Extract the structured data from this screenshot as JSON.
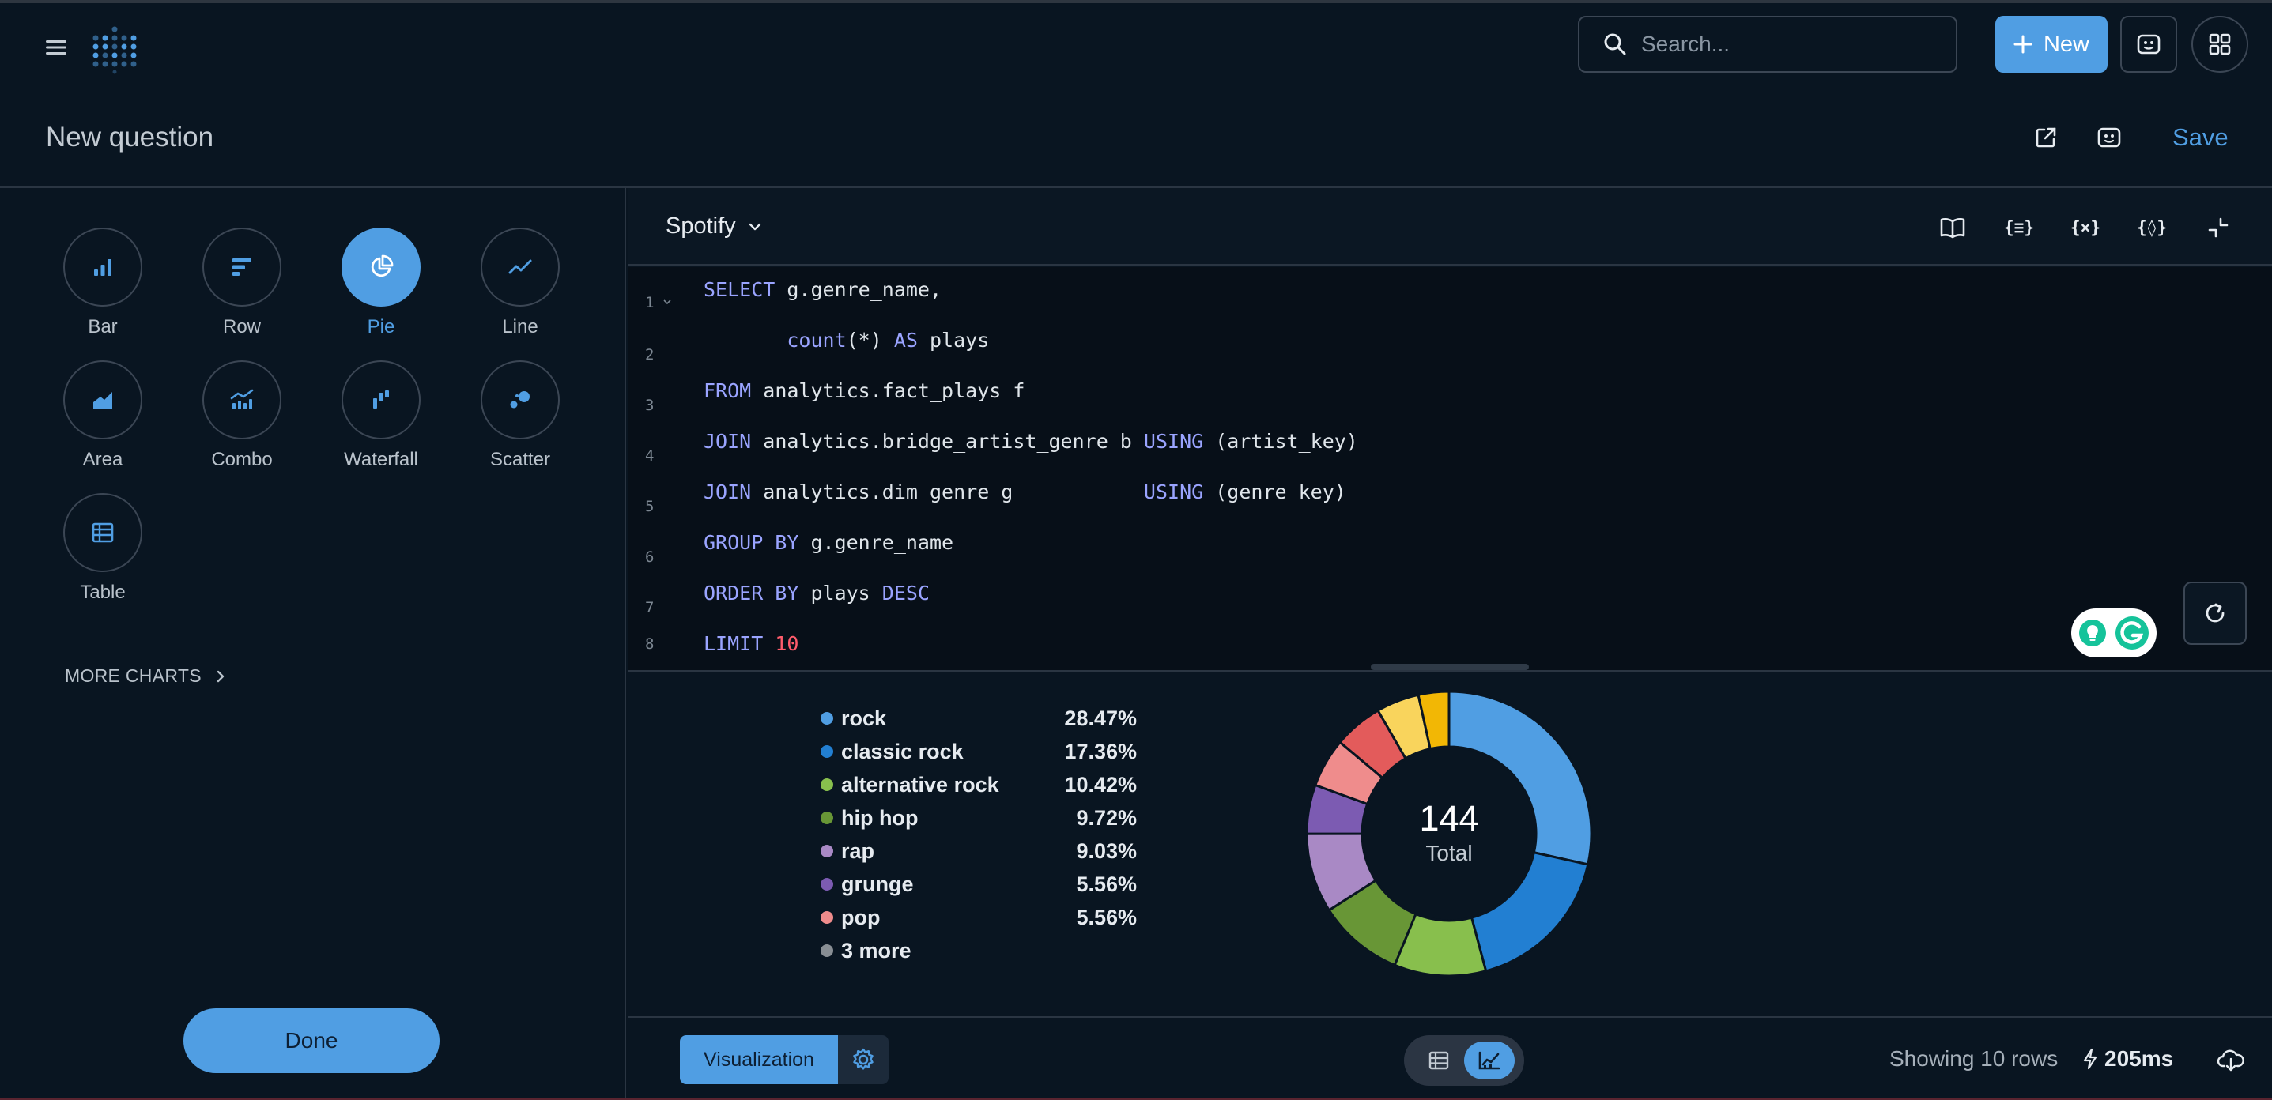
{
  "topbar": {
    "search_placeholder": "Search...",
    "new_label": "New"
  },
  "header": {
    "title": "New question",
    "save_label": "Save"
  },
  "viz_picker": {
    "items": [
      {
        "label": "Bar",
        "icon": "bar-chart-icon"
      },
      {
        "label": "Row",
        "icon": "row-chart-icon"
      },
      {
        "label": "Pie",
        "icon": "pie-chart-icon",
        "active": true
      },
      {
        "label": "Line",
        "icon": "line-chart-icon"
      },
      {
        "label": "Area",
        "icon": "area-chart-icon"
      },
      {
        "label": "Combo",
        "icon": "combo-chart-icon"
      },
      {
        "label": "Waterfall",
        "icon": "waterfall-chart-icon"
      },
      {
        "label": "Scatter",
        "icon": "scatter-chart-icon"
      },
      {
        "label": "Table",
        "icon": "table-icon"
      }
    ],
    "more_charts": "MORE CHARTS",
    "done_label": "Done"
  },
  "editor": {
    "database": "Spotify",
    "line_numbers": [
      "1",
      "2",
      "3",
      "4",
      "5",
      "6",
      "7",
      "8"
    ]
  },
  "chart_data": {
    "type": "pie",
    "categories": [
      "rock",
      "classic rock",
      "alternative rock",
      "hip hop",
      "rap",
      "grunge",
      "pop",
      "3 more"
    ],
    "percent_labels": [
      "28.47%",
      "17.36%",
      "10.42%",
      "9.72%",
      "9.03%",
      "5.56%",
      "5.56%",
      ""
    ],
    "values": [
      28.47,
      17.36,
      10.42,
      9.72,
      9.03,
      5.56,
      5.56,
      13.89
    ],
    "slice_values": [
      28.47,
      17.36,
      10.42,
      9.72,
      9.03,
      5.56,
      5.56,
      5.56,
      4.86,
      3.47
    ],
    "slice_colors": [
      "#509ee3",
      "#227fd2",
      "#88bf4d",
      "#689636",
      "#a989c5",
      "#7c5bb2",
      "#ef8c8c",
      "#e35b5b",
      "#f9d45c",
      "#f2b705"
    ],
    "legend_colors": [
      "#509ee3",
      "#227fd2",
      "#88bf4d",
      "#689636",
      "#a989c5",
      "#7c5bb2",
      "#ef8c8c",
      "#888e94"
    ],
    "total": "144",
    "total_label": "Total"
  },
  "footer": {
    "visualization_label": "Visualization",
    "rows_text": "Showing 10 rows",
    "timing": "205ms"
  }
}
